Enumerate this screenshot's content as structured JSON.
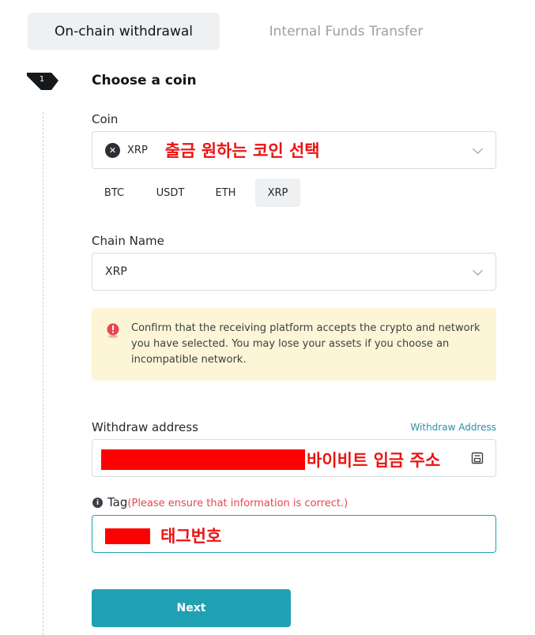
{
  "tabs": {
    "onchain": "On-chain withdrawal",
    "internal": "Internal Funds Transfer"
  },
  "step": {
    "number": "1",
    "title": "Choose a coin"
  },
  "coin": {
    "label": "Coin",
    "selected": "XRP",
    "annotation": "출금 원하는 코인 선택",
    "quick_picks": [
      "BTC",
      "USDT",
      "ETH",
      "XRP"
    ],
    "active_pick": "XRP"
  },
  "chain": {
    "label": "Chain Name",
    "selected": "XRP"
  },
  "warning": {
    "text": "Confirm that the receiving platform accepts the crypto and network you have selected. You may lose your assets if you choose an incompatible network."
  },
  "withdraw": {
    "label": "Withdraw address",
    "link": "Withdraw Address",
    "annotation": "바이비트 입금 주소"
  },
  "tag": {
    "label": "Tag",
    "note": "(Please ensure that information is correct.)",
    "annotation": "태그번호"
  },
  "next_button": "Next",
  "colors": {
    "accent": "#20a1b3",
    "link": "#2c8fa8",
    "note": "#e5484d",
    "annotation": "#ee1111",
    "warning_bg": "#fdf6d6"
  }
}
